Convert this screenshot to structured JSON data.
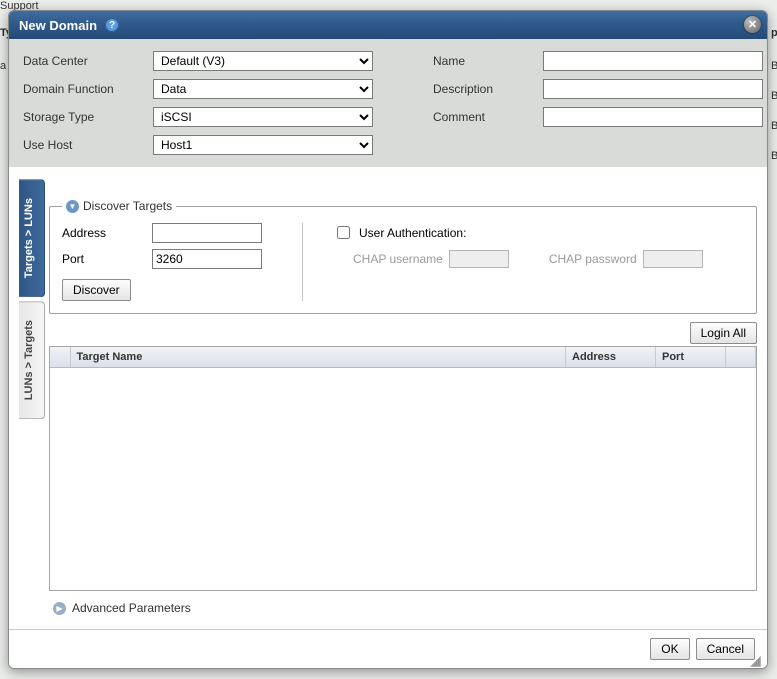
{
  "background": {
    "support": "Support",
    "ty": "Ty",
    "a": "a",
    "p": "p",
    "b": "B"
  },
  "dialog": {
    "title": "New Domain",
    "help_tip": "?",
    "close": "✕"
  },
  "form": {
    "data_center_label": "Data Center",
    "data_center_value": "Default (V3)",
    "name_label": "Name",
    "name_value": "",
    "domain_function_label": "Domain Function",
    "domain_function_value": "Data",
    "description_label": "Description",
    "description_value": "",
    "storage_type_label": "Storage Type",
    "storage_type_value": "iSCSI",
    "comment_label": "Comment",
    "comment_value": "",
    "use_host_label": "Use Host",
    "use_host_value": "Host1"
  },
  "tabs": {
    "targets_luns": "Targets > LUNs",
    "luns_targets": "LUNs > Targets"
  },
  "discover": {
    "legend": "Discover Targets",
    "address_label": "Address",
    "address_value": "",
    "port_label": "Port",
    "port_value": "3260",
    "discover_btn": "Discover",
    "user_auth_label": "User Authentication:",
    "chap_user_label": "CHAP username",
    "chap_pass_label": "CHAP password"
  },
  "targets_table": {
    "login_all": "Login All",
    "col_target": "Target Name",
    "col_address": "Address",
    "col_port": "Port"
  },
  "advanced": "Advanced Parameters",
  "footer": {
    "ok": "OK",
    "cancel": "Cancel"
  }
}
